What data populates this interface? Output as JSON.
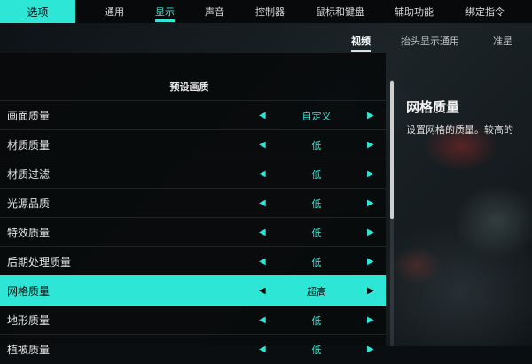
{
  "top_nav": {
    "options_label": "选项",
    "items": [
      {
        "label": "通用"
      },
      {
        "label": "显示"
      },
      {
        "label": "声音"
      },
      {
        "label": "控制器"
      },
      {
        "label": "鼠标和键盘"
      },
      {
        "label": "辅助功能"
      },
      {
        "label": "绑定指令"
      }
    ],
    "active_index": 1
  },
  "sub_tabs": {
    "items": [
      {
        "label": "视频"
      },
      {
        "label": "抬头显示通用"
      },
      {
        "label": "准星"
      }
    ],
    "active_index": 0
  },
  "settings": {
    "section_title": "预设画质",
    "rows": [
      {
        "label": "画面质量",
        "value": "自定义"
      },
      {
        "label": "材质质量",
        "value": "低"
      },
      {
        "label": "材质过滤",
        "value": "低"
      },
      {
        "label": "光源品质",
        "value": "低"
      },
      {
        "label": "特效质量",
        "value": "低"
      },
      {
        "label": "后期处理质量",
        "value": "低"
      },
      {
        "label": "网格质量",
        "value": "超高"
      },
      {
        "label": "地形质量",
        "value": "低"
      },
      {
        "label": "植被质量",
        "value": "低"
      }
    ],
    "selected_index": 6,
    "arrow_left": "◀",
    "arrow_right": "▶"
  },
  "description": {
    "title": "网格质量",
    "text": "设置网格的质量。较高的"
  },
  "colors": {
    "accent": "#2ee6d6",
    "panel": "#080a0b",
    "text": "#e4e4e4"
  }
}
